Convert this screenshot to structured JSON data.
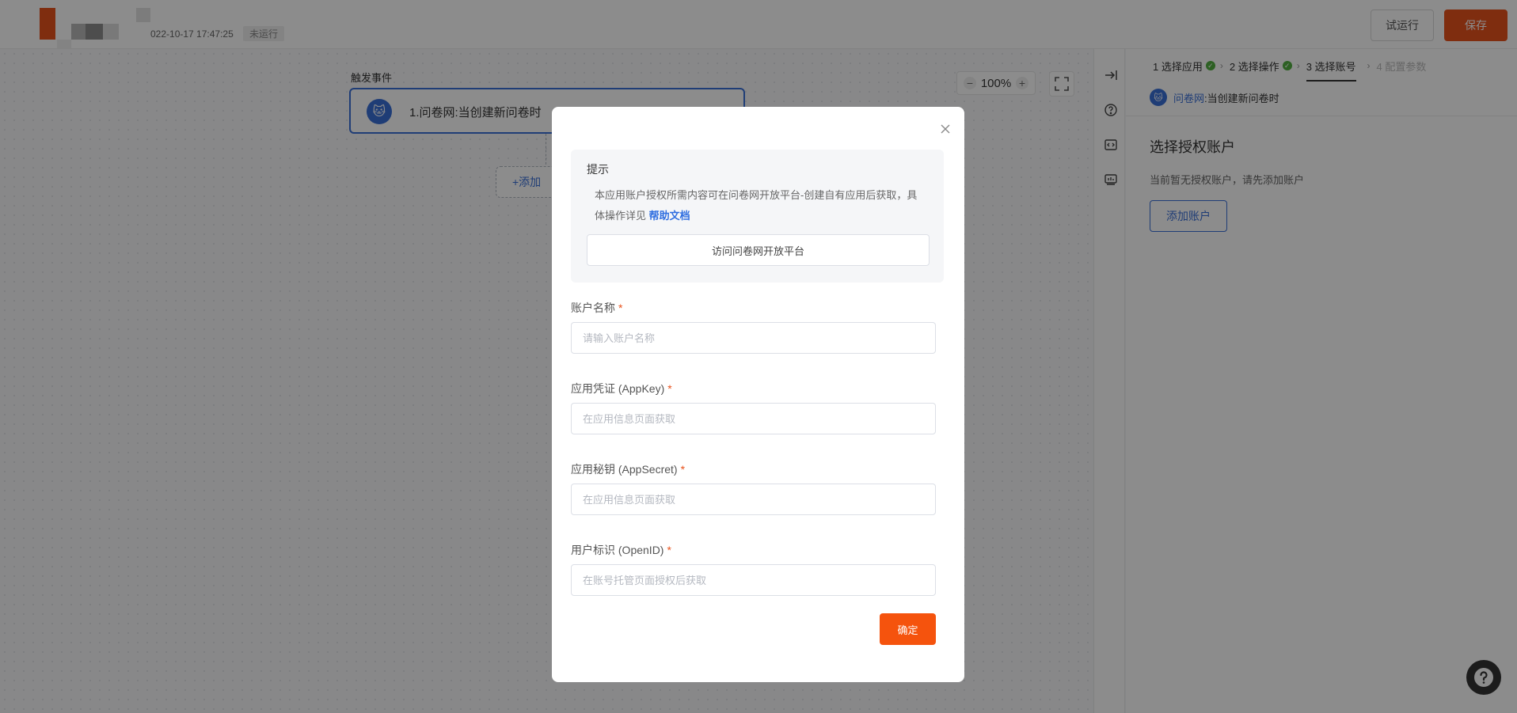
{
  "header": {
    "datetime": "022-10-17 17:47:25",
    "status": "未运行",
    "test_run_label": "试运行",
    "save_label": "保存"
  },
  "canvas": {
    "trigger_label": "触发事件",
    "trigger_card_text": "1.问卷网:当创建新问卷时",
    "add_step_label": "+添加",
    "zoom_level": "100%"
  },
  "panel": {
    "steps": [
      {
        "label": "1 选择应用",
        "state": "done"
      },
      {
        "label": "2 选择操作",
        "state": "done"
      },
      {
        "label": "3 选择账号",
        "state": "active"
      },
      {
        "label": "4 配置参数",
        "state": "disabled"
      }
    ],
    "app_name": "问卷网",
    "app_event": ":当创建新问卷时",
    "title": "选择授权账户",
    "hint": "当前暂无授权账户，请先添加账户",
    "add_account_label": "添加账户"
  },
  "modal": {
    "tip_title": "提示",
    "tip_text": "本应用账户授权所需内容可在问卷网开放平台-创建自有应用后获取，具体操作详见",
    "tip_link": "帮助文档",
    "visit_platform_label": "访问问卷网开放平台",
    "fields": [
      {
        "label": "账户名称",
        "placeholder": "请输入账户名称"
      },
      {
        "label": "应用凭证 (AppKey)",
        "placeholder": "在应用信息页面获取"
      },
      {
        "label": "应用秘钥 (AppSecret)",
        "placeholder": "在应用信息页面获取"
      },
      {
        "label": "用户标识 (OpenID)",
        "placeholder": "在账号托管页面授权后获取"
      }
    ],
    "required_mark": "*",
    "confirm_label": "确定"
  },
  "colors": {
    "brand": "#e8521c",
    "accent_blue": "#3a6fd8",
    "success": "#52b040"
  }
}
